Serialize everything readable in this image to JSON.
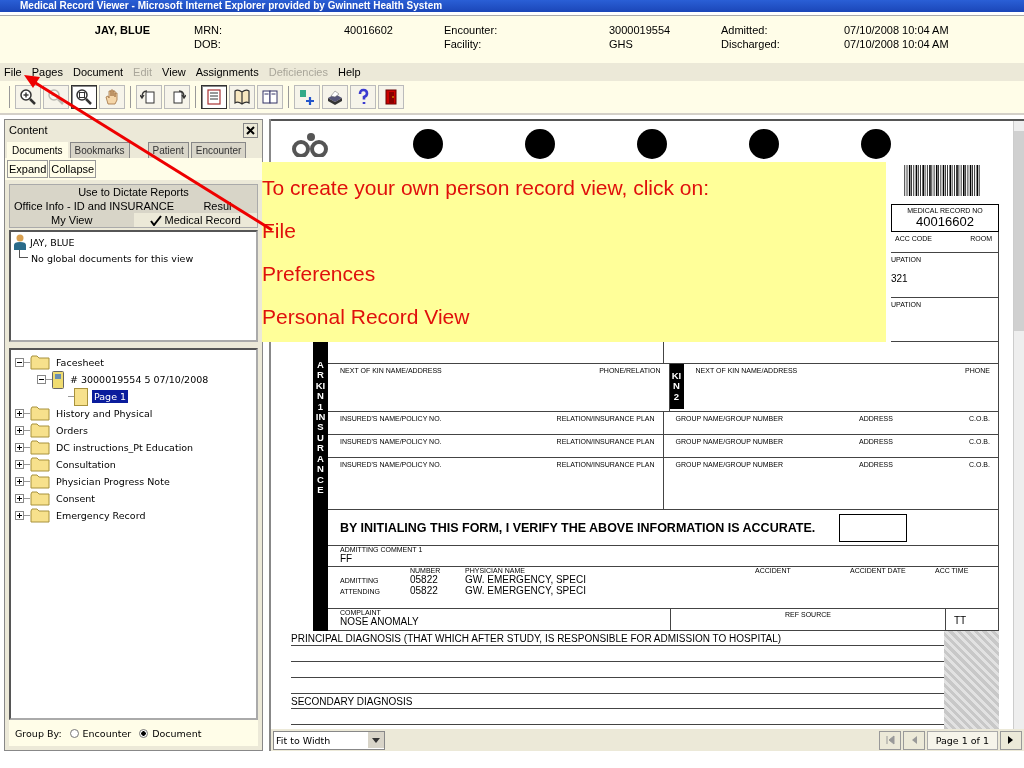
{
  "window": {
    "title": "Medical Record Viewer - Microsoft Internet Explorer provided by Gwinnett Health System"
  },
  "patient": {
    "name": "JAY, BLUE",
    "rows": [
      [
        {
          "label": "MRN:",
          "value": "40016602"
        },
        {
          "label": "Encounter:",
          "value": "3000019554"
        },
        {
          "label": "Admitted:",
          "value": "07/10/2008 10:04 AM"
        }
      ],
      [
        {
          "label": "DOB:"
        },
        {
          "label": "Facility:",
          "value": "GHS"
        },
        {
          "label": "Discharged:",
          "value": "07/10/2008 10:04 AM"
        }
      ]
    ]
  },
  "menu": [
    {
      "label": "File",
      "disabled": false
    },
    {
      "label": "Pages",
      "disabled": false
    },
    {
      "label": "Document",
      "disabled": false
    },
    {
      "label": "Edit",
      "disabled": true
    },
    {
      "label": "View",
      "disabled": false
    },
    {
      "label": "Assignments",
      "disabled": false
    },
    {
      "label": "Deficiencies",
      "disabled": true
    },
    {
      "label": "Help",
      "disabled": false
    }
  ],
  "toolbar": [
    [
      {
        "kind": "zoom-in",
        "pressed": false,
        "disabled": false
      },
      {
        "kind": "zoom-out",
        "pressed": false,
        "disabled": true
      },
      {
        "kind": "zoom-area",
        "pressed": true,
        "disabled": false
      },
      {
        "kind": "pan",
        "pressed": false,
        "disabled": false
      }
    ],
    [
      {
        "kind": "rotate-left",
        "pressed": false,
        "disabled": false
      },
      {
        "kind": "rotate-right",
        "pressed": false,
        "disabled": false
      }
    ],
    [
      {
        "kind": "single-page",
        "pressed": true,
        "disabled": false
      },
      {
        "kind": "book",
        "pressed": false,
        "disabled": false
      },
      {
        "kind": "two-page",
        "pressed": false,
        "disabled": false
      }
    ],
    [
      {
        "kind": "add-page",
        "pressed": false,
        "disabled": false
      },
      {
        "kind": "print",
        "pressed": false,
        "disabled": false
      },
      {
        "kind": "help",
        "pressed": false,
        "disabled": false
      },
      {
        "kind": "exit",
        "pressed": false,
        "disabled": false
      }
    ]
  ],
  "content_panel": {
    "title": "Content",
    "tabs": [
      {
        "label": "Documents",
        "selected": true
      },
      {
        "label": "Bookmarks",
        "selected": false
      },
      {
        "label": "Patient",
        "selected": false
      },
      {
        "label": "Encounter",
        "selected": false
      }
    ],
    "buttons": [
      "Expand",
      "Collapse"
    ],
    "views": [
      [
        {
          "label": "Use to Dictate Reports",
          "selected": false
        }
      ],
      [
        {
          "label": "Office Info - ID and INSURANCE",
          "selected": false
        },
        {
          "label": "Resul",
          "selected": false
        }
      ],
      [
        {
          "label": "My View",
          "selected": false
        },
        {
          "label": "Medical Record",
          "selected": true
        }
      ]
    ],
    "patient_tree": {
      "label": "JAY, BLUE",
      "children": [
        {
          "label": "No global documents for this view"
        }
      ]
    },
    "document_tree": [
      {
        "label": "Facesheet",
        "kind": "folder",
        "expanded": true,
        "selected": false,
        "children": [
          {
            "label": "# 3000019554  5  07/10/2008",
            "kind": "document",
            "expanded": true,
            "selected": false,
            "children": [
              {
                "label": "Page 1",
                "kind": "page",
                "selected": true
              }
            ]
          }
        ]
      },
      {
        "label": "History and Physical",
        "kind": "folder",
        "expanded": false,
        "selected": false
      },
      {
        "label": "Orders",
        "kind": "folder",
        "expanded": false,
        "selected": false
      },
      {
        "label": "DC instructions_Pt Education",
        "kind": "folder",
        "expanded": false,
        "selected": false
      },
      {
        "label": "Consultation",
        "kind": "folder",
        "expanded": false,
        "selected": false
      },
      {
        "label": "Physician Progress Note",
        "kind": "folder",
        "expanded": false,
        "selected": false
      },
      {
        "label": "Consent",
        "kind": "folder",
        "expanded": false,
        "selected": false
      },
      {
        "label": "Emergency Record",
        "kind": "folder",
        "expanded": false,
        "selected": false
      }
    ],
    "group_by": {
      "label": "Group By:",
      "options": [
        {
          "label": "Encounter",
          "selected": false
        },
        {
          "label": "Document",
          "selected": true
        }
      ]
    }
  },
  "callout": {
    "lines": [
      "To create your own person record view, click on:",
      "File",
      "Preferences",
      "Personal Record View"
    ]
  },
  "form": {
    "record_no": {
      "label": "MEDICAL RECORD NO",
      "value": "40016602"
    },
    "header_labels": [
      "ACC CODE",
      "ROOM"
    ],
    "occupation": [
      {
        "label": "UPATION",
        "value": "321"
      },
      {
        "label": "UPATION"
      }
    ],
    "kin1_letters": "ARKIN1",
    "kin2_letters": "KIN2",
    "insurance_letters": "INSURANCE",
    "kin_row": [
      "NEXT OF KIN NAME/ADDRESS",
      "PHONE/RELATION",
      "NEXT OF KIN NAME/ADDRESS",
      "PHONE"
    ],
    "insurance_rows": [
      [
        "INSURED'S NAME/POLICY NO.",
        "RELATION/INSURANCE PLAN",
        "GROUP NAME/GROUP NUMBER",
        "ADDRESS",
        "C.O.B."
      ],
      [
        "INSURED'S NAME/POLICY NO.",
        "RELATION/INSURANCE PLAN",
        "GROUP NAME/GROUP NUMBER",
        "ADDRESS",
        "C.O.B."
      ],
      [
        "INSURED'S NAME/POLICY NO.",
        "RELATION/INSURANCE PLAN",
        "GROUP NAME/GROUP NUMBER",
        "ADDRESS",
        "C.O.B."
      ]
    ],
    "verify": "BY INITIALING THIS FORM, I VERIFY THE ABOVE INFORMATION IS ACCURATE.",
    "comment": {
      "label": "ADMITTING COMMENT 1",
      "value": "FF"
    },
    "physician_headers": [
      "NUMBER",
      "PHYSICIAN NAME",
      "ACCIDENT",
      "ACCIDENT DATE",
      "ACC TIME"
    ],
    "physicians": [
      {
        "role": "ADMITTING",
        "number": "05822",
        "name": "GW. EMERGENCY, SPECI"
      },
      {
        "role": "ATTENDING",
        "number": "05822",
        "name": "GW. EMERGENCY, SPECI"
      }
    ],
    "complaint": {
      "label": "COMPLAINT",
      "value": "NOSE ANOMALY"
    },
    "ref_source": "REF SOURCE",
    "admission_type": "TT",
    "principal": "PRINCIPAL DIAGNOSIS (THAT WHICH AFTER STUDY, IS RESPONSIBLE FOR ADMISSION TO HOSPITAL)",
    "secondary": "SECONDARY DIAGNOSIS"
  },
  "viewer": {
    "zoom": "Fit to Width",
    "pager": "Page 1 of 1"
  }
}
